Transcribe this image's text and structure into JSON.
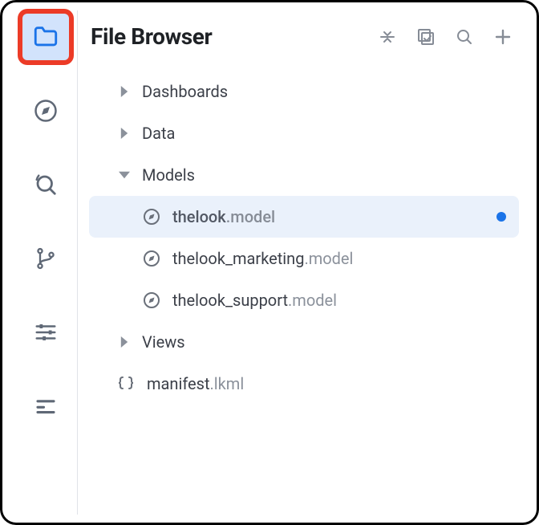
{
  "header": {
    "title": "File Browser"
  },
  "sidebar": {
    "items": [
      {
        "name": "file-browser",
        "icon": "folder-icon",
        "active": true,
        "highlighted": true
      },
      {
        "name": "explore",
        "icon": "compass-icon",
        "active": false,
        "highlighted": false
      },
      {
        "name": "history",
        "icon": "history-icon",
        "active": false,
        "highlighted": false
      },
      {
        "name": "git",
        "icon": "git-branch-icon",
        "active": false,
        "highlighted": false
      },
      {
        "name": "settings",
        "icon": "sliders-icon",
        "active": false,
        "highlighted": false
      },
      {
        "name": "panel",
        "icon": "panel-icon",
        "active": false,
        "highlighted": false
      }
    ]
  },
  "toolbar": {
    "actions": [
      {
        "name": "collapse-all",
        "icon": "collapse-icon"
      },
      {
        "name": "validate",
        "icon": "validate-icon"
      },
      {
        "name": "search",
        "icon": "search-icon"
      },
      {
        "name": "add",
        "icon": "plus-icon"
      }
    ]
  },
  "tree": {
    "items": [
      {
        "type": "folder",
        "name": "Dashboards",
        "ext": "",
        "expanded": false,
        "depth": 0,
        "selected": false,
        "modified": false
      },
      {
        "type": "folder",
        "name": "Data",
        "ext": "",
        "expanded": false,
        "depth": 0,
        "selected": false,
        "modified": false
      },
      {
        "type": "folder",
        "name": "Models",
        "ext": "",
        "expanded": true,
        "depth": 0,
        "selected": false,
        "modified": false
      },
      {
        "type": "file",
        "name": "thelook",
        "ext": ".model",
        "icon": "compass",
        "depth": 1,
        "selected": true,
        "modified": true
      },
      {
        "type": "file",
        "name": "thelook_marketing",
        "ext": ".model",
        "icon": "compass",
        "depth": 1,
        "selected": false,
        "modified": false
      },
      {
        "type": "file",
        "name": "thelook_support",
        "ext": ".model",
        "icon": "compass",
        "depth": 1,
        "selected": false,
        "modified": false
      },
      {
        "type": "folder",
        "name": "Views",
        "ext": "",
        "expanded": false,
        "depth": 0,
        "selected": false,
        "modified": false
      },
      {
        "type": "file",
        "name": "manifest",
        "ext": ".lkml",
        "icon": "braces",
        "depth": 0,
        "selected": false,
        "modified": false
      }
    ]
  },
  "colors": {
    "accent": "#1a73e8",
    "highlight_border": "#ec3b27",
    "selected_bg": "#eaf1fb"
  }
}
